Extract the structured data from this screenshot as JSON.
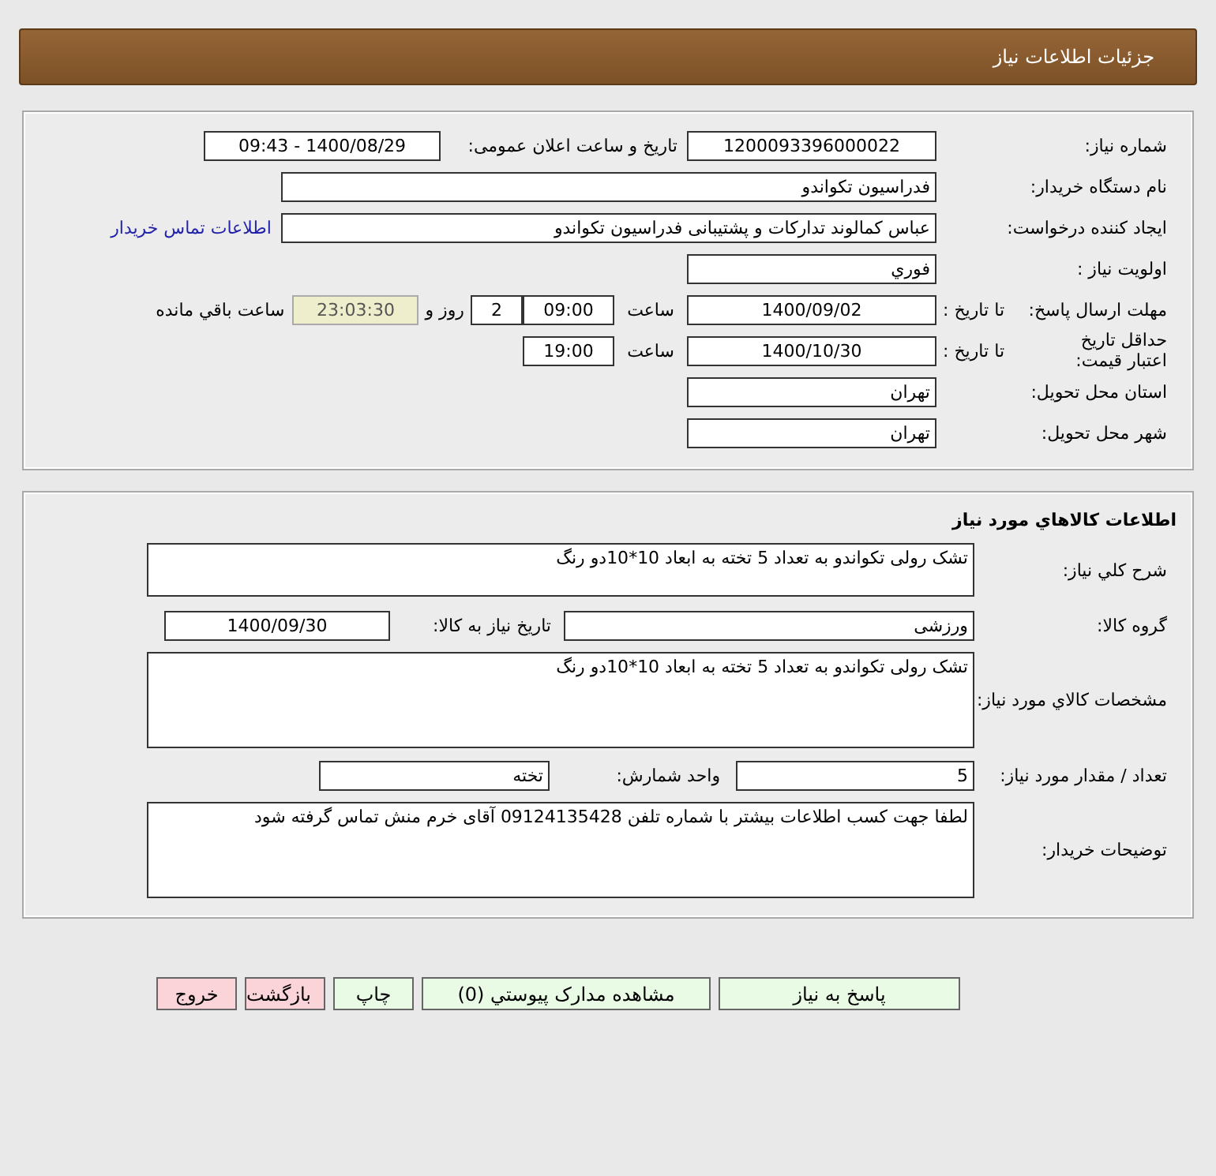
{
  "header": {
    "title": "جزئیات اطلاعات نیاز"
  },
  "request": {
    "need_number": {
      "label": "شماره نیاز:",
      "value": "1200093396000022"
    },
    "announce": {
      "label": "تاریخ و ساعت اعلان عمومی:",
      "value": "1400/08/29 - 09:43"
    },
    "buyer_org": {
      "label": "نام دستگاه خریدار:",
      "value": "فدراسیون تکواندو"
    },
    "creator": {
      "label": "ایجاد کننده درخواست:",
      "value": "عباس کمالوند تدارکات و پشتیبانی فدراسیون تکواندو"
    },
    "contact_link": "اطلاعات تماس خریدار",
    "priority": {
      "label": "اولویت نیاز :",
      "value": "فوري"
    },
    "reply_deadline": {
      "label": "مهلت ارسال پاسخ:",
      "to_date_label": "تا تاریخ :",
      "date": "1400/09/02",
      "time_label": "ساعت",
      "time": "09:00",
      "days": "2",
      "days_label": "روز و",
      "remaining": "23:03:30",
      "remaining_label": "ساعت باقي مانده"
    },
    "price_validity": {
      "label": "حداقل تاریخ اعتبار قیمت:",
      "to_date_label": "تا تاریخ :",
      "date": "1400/10/30",
      "time_label": "ساعت",
      "time": "19:00"
    },
    "province": {
      "label": "استان محل تحویل:",
      "value": "تهران"
    },
    "city": {
      "label": "شهر محل تحویل:",
      "value": "تهران"
    }
  },
  "goods": {
    "title": "اطلاعات کالاهاي مورد نیاز",
    "summary": {
      "label": "شرح کلي نیاز:",
      "value": "تشک رولی تکواندو به تعداد 5 تخته به ابعاد 10*10دو رنگ"
    },
    "group": {
      "label": "گروه کالا:",
      "value": "ورزشی"
    },
    "need_date": {
      "label": "تاریخ نیاز به کالا:",
      "value": "1400/09/30"
    },
    "specs": {
      "label": "مشخصات کالاي مورد نیاز:",
      "value": "تشک رولی تکواندو به تعداد 5 تخته به ابعاد 10*10دو رنگ"
    },
    "quantity": {
      "label": "تعداد / مقدار مورد نیاز:",
      "value": "5"
    },
    "unit": {
      "label": "واحد شمارش:",
      "value": "تخته"
    },
    "buyer_notes": {
      "label": "توضیحات خریدار:",
      "value": "لطفا جهت کسب اطلاعات بیشتر با شماره تلفن 09124135428 آقای خرم منش تماس گرفته شود"
    }
  },
  "buttons": [
    {
      "label": "پاسخ به نیاز",
      "kind": "normal"
    },
    {
      "label": "مشاهده مدارک پیوستي (0)",
      "kind": "normal"
    },
    {
      "label": "چاپ",
      "kind": "normal"
    },
    {
      "label": "بازگشت",
      "kind": "warning"
    },
    {
      "label": "خروج",
      "kind": "warning"
    }
  ]
}
